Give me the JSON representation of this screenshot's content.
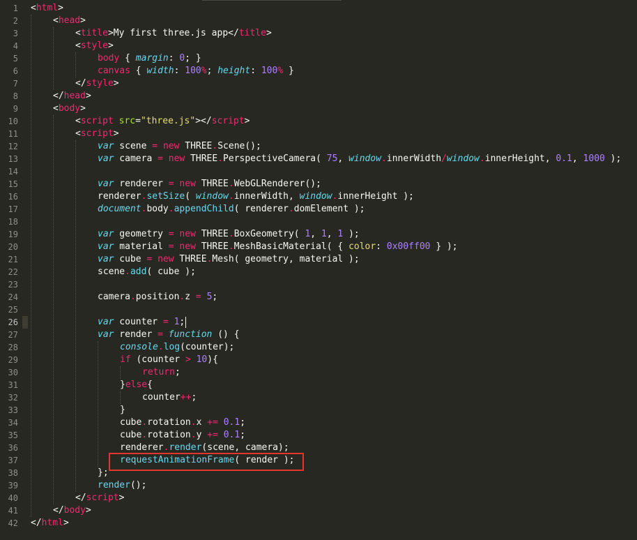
{
  "editor": {
    "active_line": 26,
    "colors": {
      "background": "#272822",
      "gutter_text": "#90908a",
      "text": "#f8f8f2",
      "tag": "#f92672",
      "keyword": "#66d9ef",
      "string": "#e6db74",
      "number": "#ae81ff",
      "function": "#a6e22e",
      "highlight_box": "#e0362e"
    }
  },
  "code_lines": [
    {
      "indent": 0,
      "tokens": [
        [
          "p",
          "<"
        ],
        [
          "t",
          "html"
        ],
        [
          "p",
          ">"
        ]
      ]
    },
    {
      "indent": 1,
      "tokens": [
        [
          "p",
          "<"
        ],
        [
          "t",
          "head"
        ],
        [
          "p",
          ">"
        ]
      ]
    },
    {
      "indent": 2,
      "tokens": [
        [
          "p",
          "<"
        ],
        [
          "t",
          "title"
        ],
        [
          "p",
          ">"
        ],
        [
          "x",
          "My first three.js app"
        ],
        [
          "p",
          "</"
        ],
        [
          "t",
          "title"
        ],
        [
          "p",
          ">"
        ]
      ]
    },
    {
      "indent": 2,
      "tokens": [
        [
          "p",
          "<"
        ],
        [
          "t",
          "style"
        ],
        [
          "p",
          ">"
        ]
      ]
    },
    {
      "indent": 3,
      "tokens": [
        [
          "t",
          "body"
        ],
        [
          "x",
          " { "
        ],
        [
          "ki",
          "margin"
        ],
        [
          "x",
          ": "
        ],
        [
          "n",
          "0"
        ],
        [
          "x",
          "; }"
        ]
      ]
    },
    {
      "indent": 3,
      "tokens": [
        [
          "t",
          "canvas"
        ],
        [
          "x",
          " { "
        ],
        [
          "ki",
          "width"
        ],
        [
          "x",
          ": "
        ],
        [
          "n",
          "100"
        ],
        [
          "t",
          "%"
        ],
        [
          "x",
          "; "
        ],
        [
          "ki",
          "height"
        ],
        [
          "x",
          ": "
        ],
        [
          "n",
          "100"
        ],
        [
          "t",
          "%"
        ],
        [
          "x",
          " }"
        ]
      ]
    },
    {
      "indent": 2,
      "tokens": [
        [
          "p",
          "</"
        ],
        [
          "t",
          "style"
        ],
        [
          "p",
          ">"
        ]
      ]
    },
    {
      "indent": 1,
      "tokens": [
        [
          "p",
          "</"
        ],
        [
          "t",
          "head"
        ],
        [
          "p",
          ">"
        ]
      ]
    },
    {
      "indent": 1,
      "tokens": [
        [
          "p",
          "<"
        ],
        [
          "t",
          "body"
        ],
        [
          "p",
          ">"
        ]
      ]
    },
    {
      "indent": 2,
      "tokens": [
        [
          "p",
          "<"
        ],
        [
          "t",
          "script"
        ],
        [
          "x",
          " "
        ],
        [
          "f",
          "src"
        ],
        [
          "x",
          "="
        ],
        [
          "s",
          "\"three.js\""
        ],
        [
          "p",
          "></"
        ],
        [
          "t",
          "script"
        ],
        [
          "p",
          ">"
        ]
      ]
    },
    {
      "indent": 2,
      "tokens": [
        [
          "p",
          "<"
        ],
        [
          "t",
          "script"
        ],
        [
          "p",
          ">"
        ]
      ]
    },
    {
      "indent": 3,
      "tokens": [
        [
          "ki",
          "var"
        ],
        [
          "x",
          " scene "
        ],
        [
          "t",
          "="
        ],
        [
          "x",
          " "
        ],
        [
          "t",
          "new"
        ],
        [
          "x",
          " THREE"
        ],
        [
          "t",
          "."
        ],
        [
          "x",
          "Scene();"
        ]
      ]
    },
    {
      "indent": 3,
      "tokens": [
        [
          "ki",
          "var"
        ],
        [
          "x",
          " camera "
        ],
        [
          "t",
          "="
        ],
        [
          "x",
          " "
        ],
        [
          "t",
          "new"
        ],
        [
          "x",
          " THREE"
        ],
        [
          "t",
          "."
        ],
        [
          "x",
          "PerspectiveCamera( "
        ],
        [
          "n",
          "75"
        ],
        [
          "x",
          ", "
        ],
        [
          "ki",
          "window"
        ],
        [
          "t",
          "."
        ],
        [
          "x",
          "innerWidth"
        ],
        [
          "t",
          "/"
        ],
        [
          "ki",
          "window"
        ],
        [
          "t",
          "."
        ],
        [
          "x",
          "innerHeight, "
        ],
        [
          "n",
          "0.1"
        ],
        [
          "x",
          ", "
        ],
        [
          "n",
          "1000"
        ],
        [
          "x",
          " );"
        ]
      ]
    },
    {
      "indent": 0,
      "tokens": []
    },
    {
      "indent": 3,
      "tokens": [
        [
          "ki",
          "var"
        ],
        [
          "x",
          " renderer "
        ],
        [
          "t",
          "="
        ],
        [
          "x",
          " "
        ],
        [
          "t",
          "new"
        ],
        [
          "x",
          " THREE"
        ],
        [
          "t",
          "."
        ],
        [
          "x",
          "WebGLRenderer();"
        ]
      ]
    },
    {
      "indent": 3,
      "tokens": [
        [
          "x",
          "renderer"
        ],
        [
          "t",
          "."
        ],
        [
          "k",
          "setSize"
        ],
        [
          "x",
          "( "
        ],
        [
          "ki",
          "window"
        ],
        [
          "t",
          "."
        ],
        [
          "x",
          "innerWidth, "
        ],
        [
          "ki",
          "window"
        ],
        [
          "t",
          "."
        ],
        [
          "x",
          "innerHeight );"
        ]
      ]
    },
    {
      "indent": 3,
      "tokens": [
        [
          "ki",
          "document"
        ],
        [
          "t",
          "."
        ],
        [
          "x",
          "body"
        ],
        [
          "t",
          "."
        ],
        [
          "k",
          "appendChild"
        ],
        [
          "x",
          "( renderer"
        ],
        [
          "t",
          "."
        ],
        [
          "x",
          "domElement );"
        ]
      ]
    },
    {
      "indent": 0,
      "tokens": []
    },
    {
      "indent": 3,
      "tokens": [
        [
          "ki",
          "var"
        ],
        [
          "x",
          " geometry "
        ],
        [
          "t",
          "="
        ],
        [
          "x",
          " "
        ],
        [
          "t",
          "new"
        ],
        [
          "x",
          " THREE"
        ],
        [
          "t",
          "."
        ],
        [
          "x",
          "BoxGeometry( "
        ],
        [
          "n",
          "1"
        ],
        [
          "x",
          ", "
        ],
        [
          "n",
          "1"
        ],
        [
          "x",
          ", "
        ],
        [
          "n",
          "1"
        ],
        [
          "x",
          " );"
        ]
      ]
    },
    {
      "indent": 3,
      "tokens": [
        [
          "ki",
          "var"
        ],
        [
          "x",
          " material "
        ],
        [
          "t",
          "="
        ],
        [
          "x",
          " "
        ],
        [
          "t",
          "new"
        ],
        [
          "x",
          " THREE"
        ],
        [
          "t",
          "."
        ],
        [
          "x",
          "MeshBasicMaterial( { "
        ],
        [
          "s",
          "color"
        ],
        [
          "x",
          ": "
        ],
        [
          "n",
          "0x00ff00"
        ],
        [
          "x",
          " } );"
        ]
      ]
    },
    {
      "indent": 3,
      "tokens": [
        [
          "ki",
          "var"
        ],
        [
          "x",
          " cube "
        ],
        [
          "t",
          "="
        ],
        [
          "x",
          " "
        ],
        [
          "t",
          "new"
        ],
        [
          "x",
          " THREE"
        ],
        [
          "t",
          "."
        ],
        [
          "x",
          "Mesh( geometry, material );"
        ]
      ]
    },
    {
      "indent": 3,
      "tokens": [
        [
          "x",
          "scene"
        ],
        [
          "t",
          "."
        ],
        [
          "k",
          "add"
        ],
        [
          "x",
          "( cube );"
        ]
      ]
    },
    {
      "indent": 0,
      "tokens": []
    },
    {
      "indent": 3,
      "tokens": [
        [
          "x",
          "camera"
        ],
        [
          "t",
          "."
        ],
        [
          "x",
          "position"
        ],
        [
          "t",
          "."
        ],
        [
          "x",
          "z "
        ],
        [
          "t",
          "="
        ],
        [
          "x",
          " "
        ],
        [
          "n",
          "5"
        ],
        [
          "x",
          ";"
        ]
      ]
    },
    {
      "indent": 0,
      "tokens": []
    },
    {
      "indent": 3,
      "tokens": [
        [
          "ki",
          "var"
        ],
        [
          "x",
          " counter "
        ],
        [
          "t",
          "="
        ],
        [
          "x",
          " "
        ],
        [
          "n",
          "1"
        ],
        [
          "x",
          ";"
        ]
      ]
    },
    {
      "indent": 3,
      "tokens": [
        [
          "ki",
          "var"
        ],
        [
          "x",
          " render "
        ],
        [
          "t",
          "="
        ],
        [
          "x",
          " "
        ],
        [
          "ki",
          "function"
        ],
        [
          "x",
          " () {"
        ]
      ]
    },
    {
      "indent": 4,
      "tokens": [
        [
          "ki",
          "console"
        ],
        [
          "t",
          "."
        ],
        [
          "k",
          "log"
        ],
        [
          "x",
          "(counter);"
        ]
      ]
    },
    {
      "indent": 4,
      "tokens": [
        [
          "t",
          "if"
        ],
        [
          "x",
          " (counter "
        ],
        [
          "t",
          ">"
        ],
        [
          "x",
          " "
        ],
        [
          "n",
          "10"
        ],
        [
          "x",
          "){"
        ]
      ]
    },
    {
      "indent": 5,
      "tokens": [
        [
          "t",
          "return"
        ],
        [
          "x",
          ";"
        ]
      ]
    },
    {
      "indent": 4,
      "tokens": [
        [
          "x",
          "}"
        ],
        [
          "t",
          "else"
        ],
        [
          "x",
          "{"
        ]
      ]
    },
    {
      "indent": 5,
      "tokens": [
        [
          "x",
          "counter"
        ],
        [
          "t",
          "++"
        ],
        [
          "x",
          ";"
        ]
      ]
    },
    {
      "indent": 4,
      "tokens": [
        [
          "x",
          "}"
        ]
      ]
    },
    {
      "indent": 4,
      "tokens": [
        [
          "x",
          "cube"
        ],
        [
          "t",
          "."
        ],
        [
          "x",
          "rotation"
        ],
        [
          "t",
          "."
        ],
        [
          "x",
          "x "
        ],
        [
          "t",
          "+="
        ],
        [
          "x",
          " "
        ],
        [
          "n",
          "0.1"
        ],
        [
          "x",
          ";"
        ]
      ]
    },
    {
      "indent": 4,
      "tokens": [
        [
          "x",
          "cube"
        ],
        [
          "t",
          "."
        ],
        [
          "x",
          "rotation"
        ],
        [
          "t",
          "."
        ],
        [
          "x",
          "y "
        ],
        [
          "t",
          "+="
        ],
        [
          "x",
          " "
        ],
        [
          "n",
          "0.1"
        ],
        [
          "x",
          ";"
        ]
      ]
    },
    {
      "indent": 4,
      "tokens": [
        [
          "x",
          "renderer"
        ],
        [
          "t",
          "."
        ],
        [
          "k",
          "render"
        ],
        [
          "x",
          "(scene, camera);"
        ]
      ]
    },
    {
      "indent": 4,
      "tokens": [
        [
          "k",
          "requestAnimationFrame"
        ],
        [
          "x",
          "( render );"
        ]
      ]
    },
    {
      "indent": 3,
      "tokens": [
        [
          "x",
          "};"
        ]
      ]
    },
    {
      "indent": 3,
      "tokens": [
        [
          "k",
          "render"
        ],
        [
          "x",
          "();"
        ]
      ]
    },
    {
      "indent": 2,
      "tokens": [
        [
          "p",
          "</"
        ],
        [
          "t",
          "script"
        ],
        [
          "p",
          ">"
        ]
      ]
    },
    {
      "indent": 1,
      "tokens": [
        [
          "p",
          "</"
        ],
        [
          "t",
          "body"
        ],
        [
          "p",
          ">"
        ]
      ]
    },
    {
      "indent": 0,
      "tokens": [
        [
          "p",
          "</"
        ],
        [
          "t",
          "html"
        ],
        [
          "p",
          ">"
        ]
      ]
    }
  ]
}
